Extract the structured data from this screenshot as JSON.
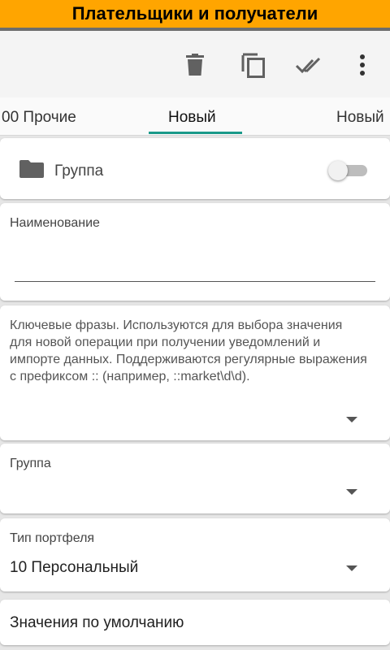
{
  "window": {
    "title": "Плательщики и получатели"
  },
  "toolbar": {
    "delete_icon": "trash-icon",
    "copy_icon": "copy-icon",
    "confirm_icon": "double-check-icon",
    "more_icon": "more-vertical-icon"
  },
  "tabs": [
    {
      "label": "00 Прочие"
    },
    {
      "label": "Новый"
    },
    {
      "label": "Новый"
    }
  ],
  "group_toggle": {
    "label": "Группа",
    "icon": "folder-icon",
    "checked": false
  },
  "name_field": {
    "label": "Наименование",
    "value": ""
  },
  "keywords_field": {
    "hint": "Ключевые фразы. Используются для выбора значения для новой операции при получении уведомлений и импорте данных. Поддерживаются регулярные выражения с префиксом :: (например, ::market\\d\\d).",
    "value": ""
  },
  "group_select": {
    "label": "Группа",
    "value": ""
  },
  "portfolio_type": {
    "label": "Тип портфеля",
    "value": "10 Персональный"
  },
  "defaults_section": {
    "label": "Значения по умолчанию"
  },
  "colors": {
    "title_bg": "#ffa500",
    "accent": "#1a9a8a",
    "icon": "#616161"
  }
}
